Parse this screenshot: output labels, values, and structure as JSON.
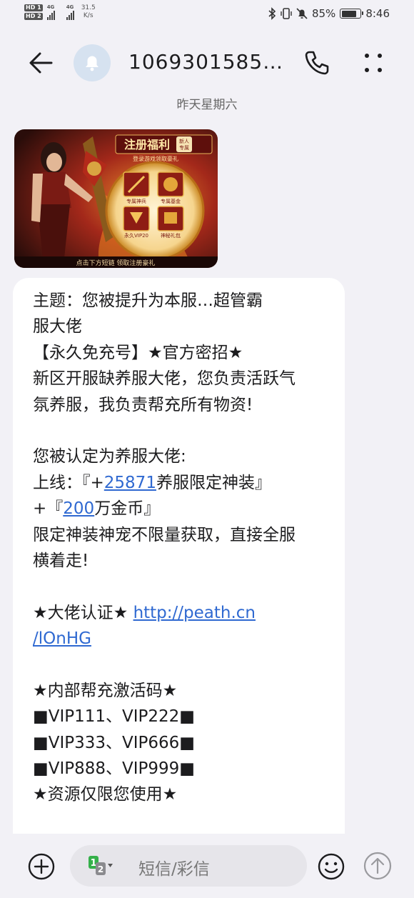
{
  "status_bar": {
    "hd1": "HD 1",
    "hd2": "HD 2",
    "net1": "4G",
    "net2": "4G",
    "speed_value": "31.5",
    "speed_unit": "K/s",
    "battery_pct": "85%",
    "battery_level": 0.85,
    "time": "8:46"
  },
  "header": {
    "title": "1069301585…"
  },
  "date_label": "昨天星期六",
  "banner": {
    "heading": "注册福利",
    "badge_line1": "新人",
    "badge_line2": "专属",
    "subheading": "登录游戏领取豪礼",
    "rewards": [
      "专属神兵",
      "专属基金",
      "永久VIP20",
      "神秘礼包"
    ],
    "footer": "点击下方短链 领取注册豪礼"
  },
  "message": {
    "l1": "主题：您被提升为本服…超管霸",
    "l2": "服大佬",
    "l3": "【永久免充号】★官方密招★",
    "l4": "新区开服缺养服大佬，您负责活跃气",
    "l5": "氛养服，我负责帮充所有物资!",
    "l6": "您被认定为养服大佬:",
    "l7_prefix": "上线：『+",
    "l7_link": "25871",
    "l7_suffix": "养服限定神装』",
    "l8_prefix": "+『",
    "l8_link": "200",
    "l8_suffix": "万金币』",
    "l9": "限定神装神宠不限量获取，直接全服",
    "l10": "横着走!",
    "l11_prefix": "★大佬认证★ ",
    "l11_link": "http://peath.cn",
    "l12_link": "/lOnHG",
    "l13": "★内部帮充激活码★",
    "l14": "■VIP111、VIP222■",
    "l15": "■VIP333、VIP666■",
    "l16": "■VIP888、VIP999■",
    "l17": "★资源仅限您使用★"
  },
  "composer": {
    "placeholder": "短信/彩信",
    "sim_primary": "1",
    "sim_secondary": "2"
  },
  "colors": {
    "background": "#f2f1f6",
    "bubble": "#ffffff",
    "link": "#2f69d1",
    "avatar_bg": "#d6e2f0"
  }
}
